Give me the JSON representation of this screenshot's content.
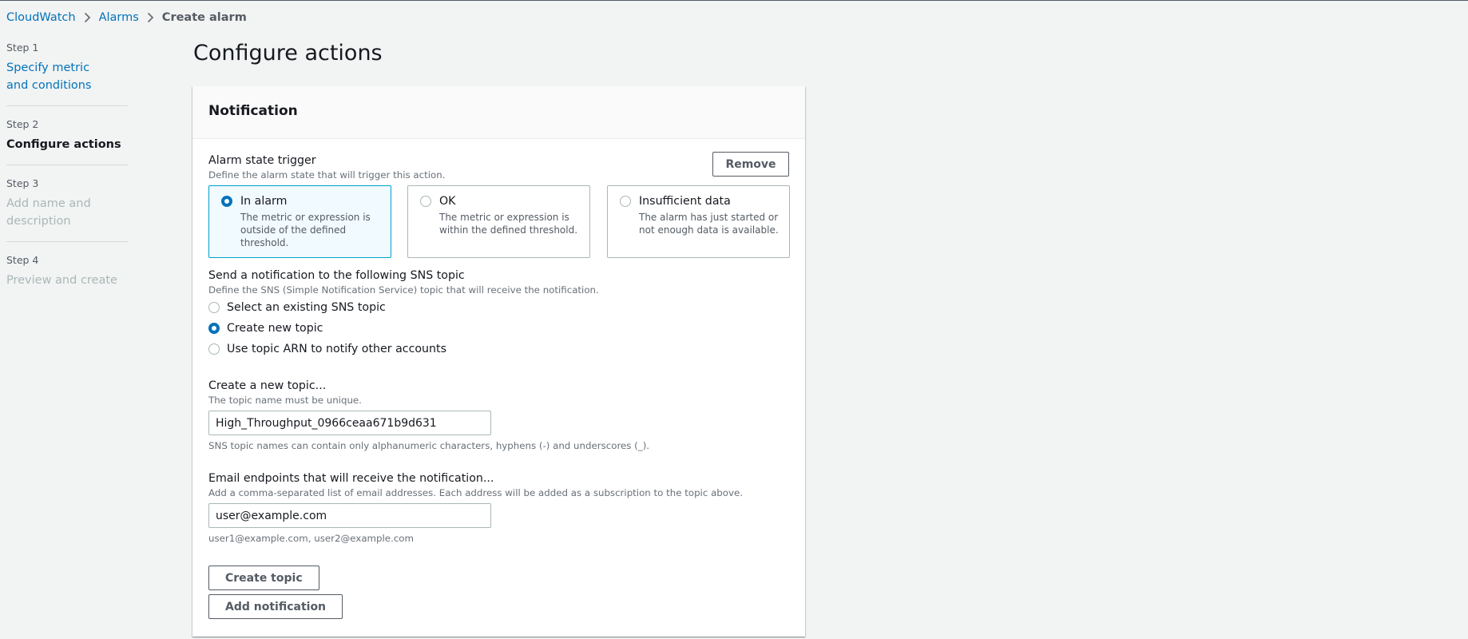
{
  "breadcrumb": {
    "items": [
      {
        "label": "CloudWatch"
      },
      {
        "label": "Alarms"
      },
      {
        "label": "Create alarm"
      }
    ]
  },
  "steps": [
    {
      "number": "Step 1",
      "title": "Specify metric and conditions",
      "state": "link"
    },
    {
      "number": "Step 2",
      "title": "Configure actions",
      "state": "active"
    },
    {
      "number": "Step 3",
      "title": "Add name and description",
      "state": "disabled"
    },
    {
      "number": "Step 4",
      "title": "Preview and create",
      "state": "disabled"
    }
  ],
  "page_title": "Configure actions",
  "notification": {
    "title": "Notification",
    "remove_label": "Remove",
    "alarm_state": {
      "label": "Alarm state trigger",
      "description": "Define the alarm state that will trigger this action.",
      "options": [
        {
          "label": "In alarm",
          "description": "The metric or expression is outside of the defined threshold.",
          "selected": true
        },
        {
          "label": "OK",
          "description": "The metric or expression is within the defined threshold.",
          "selected": false
        },
        {
          "label": "Insufficient data",
          "description": "The alarm has just started or not enough data is available.",
          "selected": false
        }
      ]
    },
    "sns": {
      "label": "Send a notification to the following SNS topic",
      "description": "Define the SNS (Simple Notification Service) topic that will receive the notification.",
      "options": [
        {
          "label": "Select an existing SNS topic",
          "selected": false
        },
        {
          "label": "Create new topic",
          "selected": true
        },
        {
          "label": "Use topic ARN to notify other accounts",
          "selected": false
        }
      ]
    },
    "new_topic": {
      "label": "Create a new topic...",
      "description": "The topic name must be unique.",
      "value": "High_Throughput_0966ceaa671b9d631",
      "constraint": "SNS topic names can contain only alphanumeric characters, hyphens (-) and underscores (_)."
    },
    "email": {
      "label": "Email endpoints that will receive the notification...",
      "description": "Add a comma-separated list of email addresses. Each address will be added as a subscription to the topic above.",
      "value": "user@example.com",
      "constraint": "user1@example.com, user2@example.com"
    },
    "create_topic_label": "Create topic",
    "add_notification_label": "Add notification"
  },
  "colors": {
    "accent": "#0073bb",
    "selected_tile_border": "#00a1c9",
    "selected_tile_bg": "#f1faff",
    "page_bg": "#f2f3f3"
  }
}
